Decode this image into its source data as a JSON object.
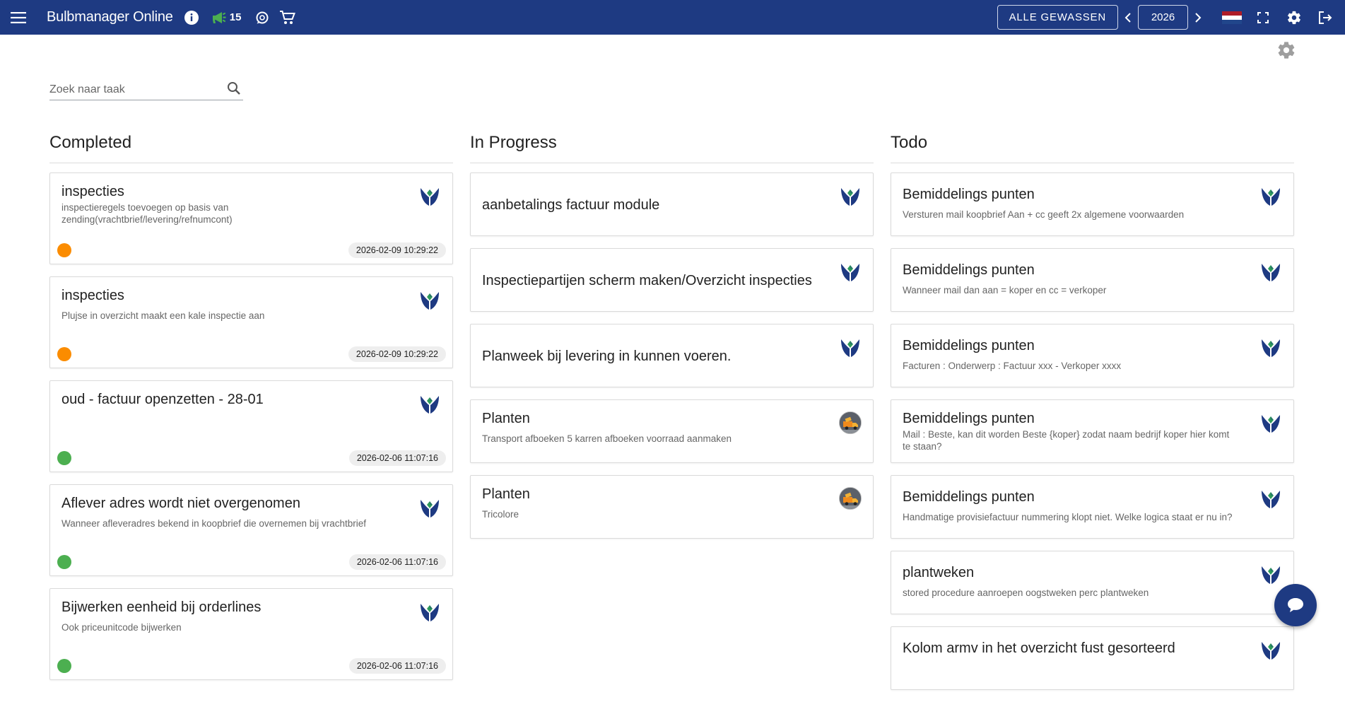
{
  "header": {
    "app_title": "Bulbmanager Online",
    "notification_count": "15",
    "crops_button": "ALLE GEWASSEN",
    "year": "2026"
  },
  "search": {
    "placeholder": "Zoek naar taak"
  },
  "columns": [
    {
      "title": "Completed",
      "cards": [
        {
          "title": "inspecties",
          "description": "inspectieregels toevoegen op basis van zending(vrachtbrief/levering/refnumcont)",
          "timestamp": "2026-02-09 10:29:22",
          "status_color": "#fb8c00"
        },
        {
          "title": "inspecties",
          "description": "Plujse in overzicht maakt een kale inspectie aan",
          "timestamp": "2026-02-09 10:29:22",
          "status_color": "#fb8c00"
        },
        {
          "title": "oud - factuur openzetten - 28-01",
          "description": "",
          "timestamp": "2026-02-06 11:07:16",
          "status_color": "#4caf50"
        },
        {
          "title": "Aflever adres wordt niet overgenomen",
          "description": "Wanneer afleveradres bekend in koopbrief die overnemen bij vrachtbrief",
          "timestamp": "2026-02-06 11:07:16",
          "status_color": "#4caf50"
        },
        {
          "title": "Bijwerken eenheid bij orderlines",
          "description": "Ook priceunitcode bijwerken",
          "timestamp": "2026-02-06 11:07:16",
          "status_color": "#4caf50"
        }
      ]
    },
    {
      "title": "In Progress",
      "cards": [
        {
          "title": "aanbetalings factuur module",
          "description": "",
          "avatar": "logo"
        },
        {
          "title": "Inspectiepartijen scherm maken/Overzicht inspecties",
          "description": "",
          "avatar": "logo"
        },
        {
          "title": "Planweek bij levering in kunnen voeren.",
          "description": "",
          "avatar": "logo"
        },
        {
          "title": "Planten",
          "description": "Transport afboeken 5 karren afboeken voorraad aanmaken",
          "avatar": "truck"
        },
        {
          "title": "Planten",
          "description": "Tricolore",
          "avatar": "truck"
        }
      ]
    },
    {
      "title": "Todo",
      "cards": [
        {
          "title": "Bemiddelings punten",
          "description": "Versturen mail koopbrief Aan + cc geeft 2x algemene voorwaarden"
        },
        {
          "title": "Bemiddelings punten",
          "description": "Wanneer mail dan aan = koper en cc = verkoper"
        },
        {
          "title": "Bemiddelings punten",
          "description": "Facturen : Onderwerp : Factuur xxx - Verkoper xxxx"
        },
        {
          "title": "Bemiddelings punten",
          "description": "Mail : Beste, kan dit worden Beste {koper} zodat naam bedrijf koper hier komt te staan?"
        },
        {
          "title": "Bemiddelings punten",
          "description": "Handmatige provisiefactuur nummering klopt niet. Welke logica staat er nu in?"
        },
        {
          "title": "plantweken",
          "description": "stored procedure aanroepen oogstweken perc plantweken"
        },
        {
          "title": "Kolom armv in het overzicht fust gesorteerd",
          "description": ""
        }
      ]
    }
  ]
}
